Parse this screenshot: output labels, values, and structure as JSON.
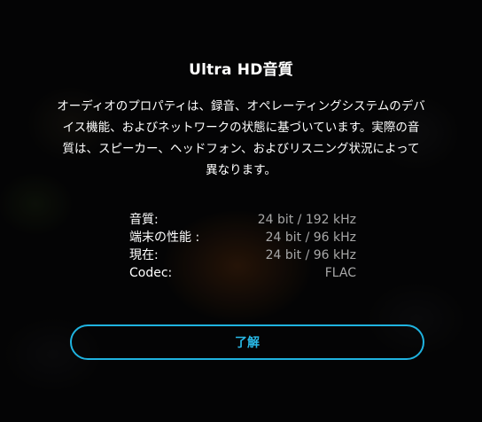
{
  "dialog": {
    "title": "Ultra HD音質",
    "description": "オーディオのプロパティは、録音、オペレーティングシステムのデバイス機能、およびネットワークの状態に基づいています。実際の音質は、スピーカー、ヘッドフォン、およびリスニング状況によって異なります。",
    "info": [
      {
        "label": "音質:",
        "value": "24 bit / 192 kHz"
      },
      {
        "label": "端末の性能 :",
        "value": "24 bit / 96 kHz"
      },
      {
        "label": "現在:",
        "value": "24 bit / 96 kHz"
      },
      {
        "label": "Codec:",
        "value": "FLAC"
      }
    ],
    "ok_label": "了解"
  },
  "colors": {
    "accent": "#1fb3e0",
    "text": "#ffffff",
    "muted_value": "#a8a8a8"
  }
}
